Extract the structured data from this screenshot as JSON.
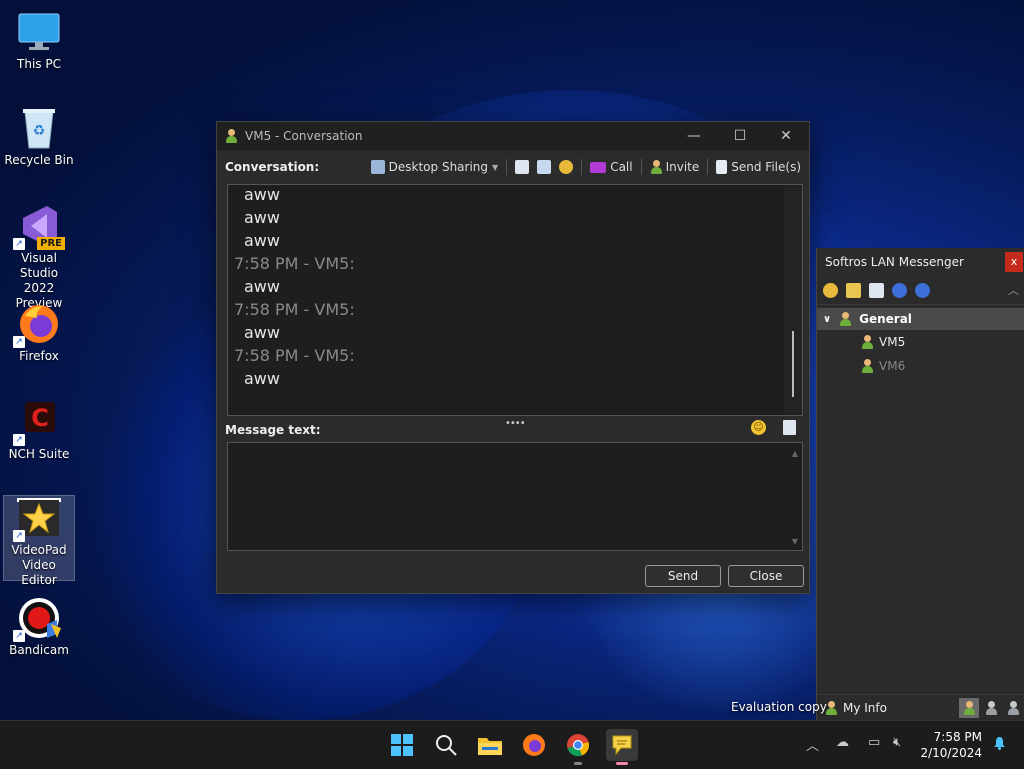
{
  "desktop": {
    "icons": [
      {
        "label": "This PC"
      },
      {
        "label": "Recycle Bin"
      },
      {
        "label": "Visual Studio 2022 Preview",
        "badge": "PRE"
      },
      {
        "label": "Firefox"
      },
      {
        "label": "NCH Suite"
      },
      {
        "label": "VideoPad Video Editor"
      },
      {
        "label": "Bandicam"
      }
    ],
    "watermark": "Evaluation copy"
  },
  "conversation": {
    "title": "VM5 - Conversation",
    "conversation_label": "Conversation:",
    "toolbar": {
      "desktop_sharing": "Desktop Sharing",
      "call": "Call",
      "invite": "Invite",
      "send_files": "Send File(s)"
    },
    "messages": [
      {
        "body": "aww"
      },
      {
        "body": "aww"
      },
      {
        "body": "aww"
      },
      {
        "header": "7:58 PM - VM5:",
        "body": "aww"
      },
      {
        "header": "7:58 PM - VM5:",
        "body": "aww"
      },
      {
        "header": "7:58 PM - VM5:",
        "body": "aww"
      }
    ],
    "message_label": "Message text:",
    "message_value": "",
    "send_label": "Send",
    "close_label": "Close"
  },
  "messenger": {
    "title": "Softros LAN Messenger",
    "close_glyph": "x",
    "group": "General",
    "contacts": [
      {
        "name": "VM5",
        "online": true
      },
      {
        "name": "VM6",
        "online": false
      }
    ],
    "my_info": "My Info"
  },
  "taskbar": {
    "time": "7:58 PM",
    "date": "2/10/2024"
  },
  "colors": {
    "accent_red": "#c42b1c",
    "call_purple": "#b23ad6",
    "online_green": "#6fae3a"
  }
}
